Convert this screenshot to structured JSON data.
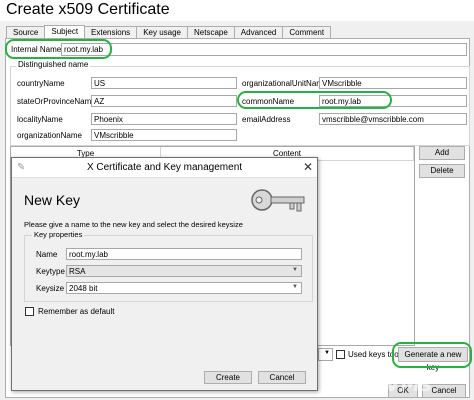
{
  "window": {
    "title": "Create x509 Certificate"
  },
  "tabs": [
    "Source",
    "Subject",
    "Extensions",
    "Key usage",
    "Netscape",
    "Advanced",
    "Comment"
  ],
  "subject": {
    "internal_name_label": "Internal Name",
    "internal_name_value": "root.my.lab",
    "dn_group_title": "Distinguished name",
    "fields": {
      "country_label": "countryName",
      "country_value": "US",
      "state_label": "stateOrProvinceName",
      "state_value": "AZ",
      "locality_label": "localityName",
      "locality_value": "Phoenix",
      "org_label": "organizationName",
      "org_value": "VMscribble",
      "ou_label": "organizationalUnitName",
      "ou_value": "VMscribble",
      "cn_label": "commonName",
      "cn_value": "root.my.lab",
      "email_label": "emailAddress",
      "email_value": "vmscribble@vmscribble.com"
    },
    "table_headers": [
      "Type",
      "Content"
    ],
    "add_label": "Add",
    "delete_label": "Delete",
    "used_keys_label": "Used keys too",
    "generate_label": "Generate a new key",
    "ok_label": "OK",
    "cancel_label": "Cancel"
  },
  "dialog": {
    "title": "X Certificate and Key management",
    "heading": "New Key",
    "description": "Please give a name to the new key and select the desired keysize",
    "group_title": "Key properties",
    "name_label": "Name",
    "name_value": "root.my.lab",
    "keytype_label": "Keytype",
    "keytype_value": "RSA",
    "keysize_label": "Keysize",
    "keysize_value": "2048 bit",
    "remember_label": "Remember as default",
    "create_label": "Create",
    "cancel_label": "Cancel"
  },
  "icons": {
    "key": "key-icon",
    "close": "close-icon",
    "app": "app-icon"
  },
  "colors": {
    "highlight": "#29b044"
  },
  "watermark": "VMscribble"
}
